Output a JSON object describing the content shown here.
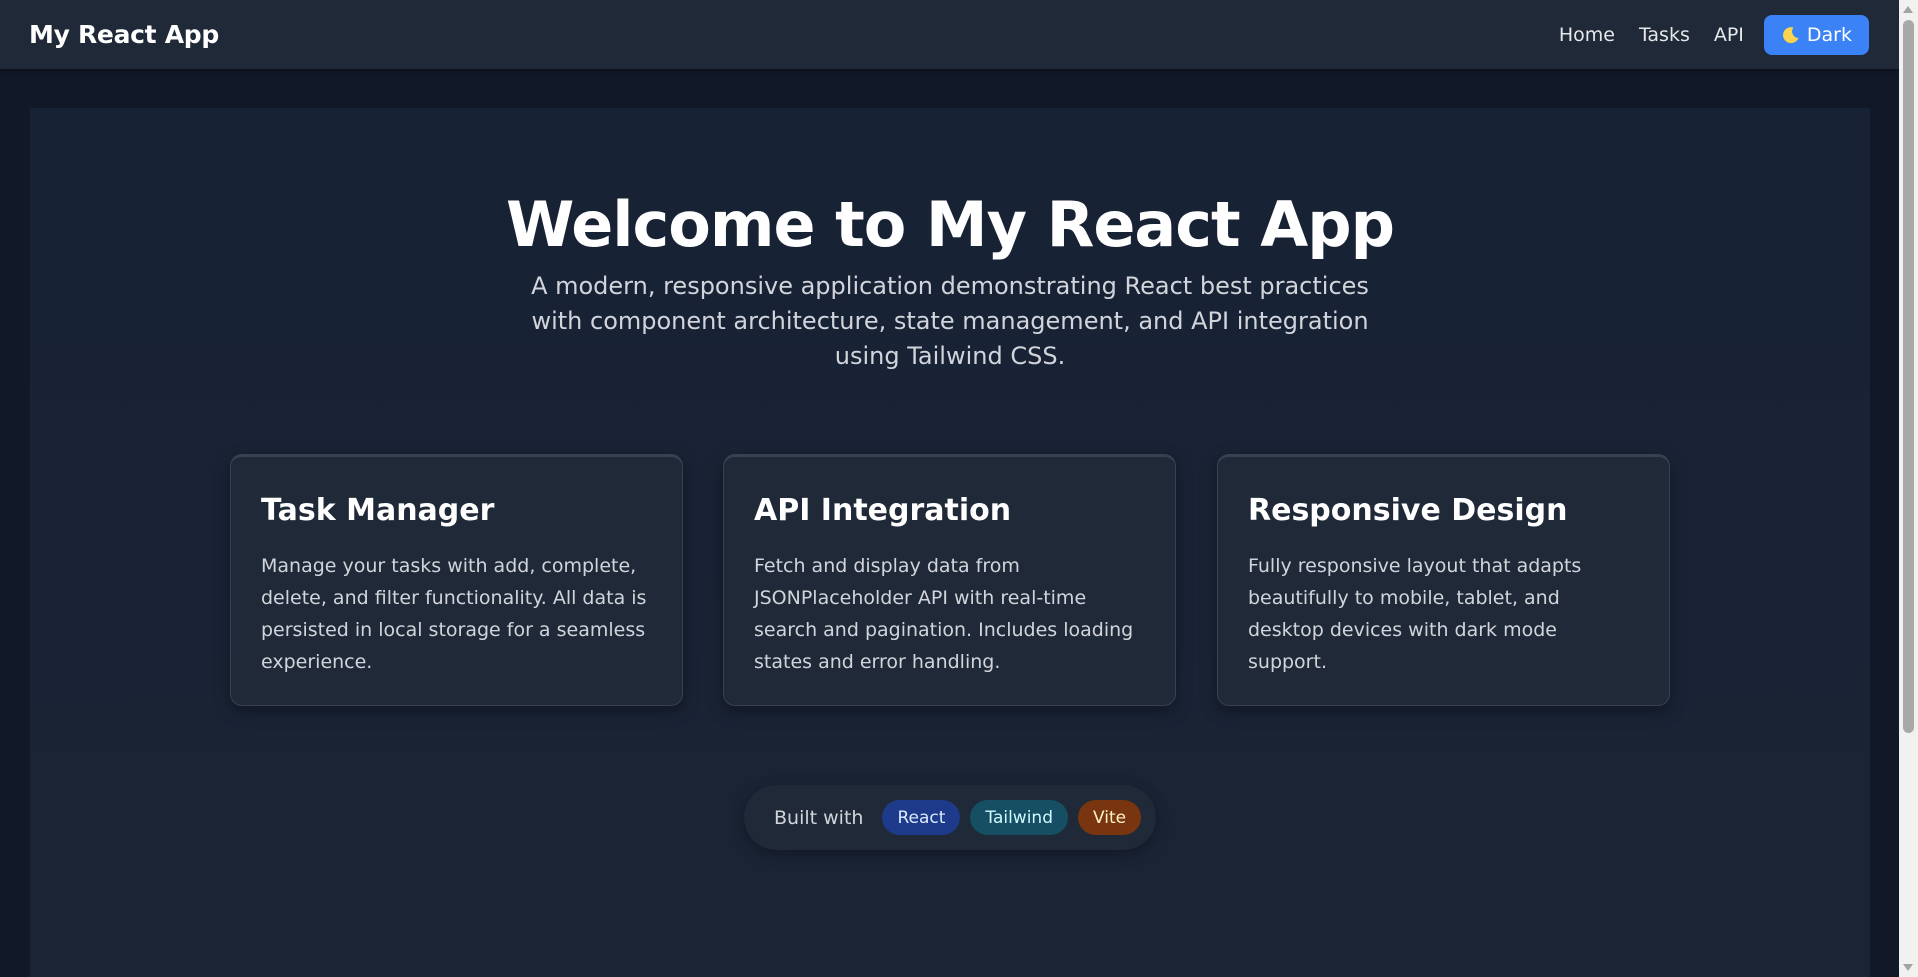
{
  "navbar": {
    "brand": "My React App",
    "links": [
      "Home",
      "Tasks",
      "API"
    ],
    "theme_button": {
      "icon": "moon-icon",
      "label": "Dark"
    }
  },
  "hero": {
    "title": "Welcome to My React App",
    "subtitle": "A modern, responsive application demonstrating React best practices with component architecture, state management, and API integration using Tailwind CSS."
  },
  "features": [
    {
      "title": "Task Manager",
      "description": "Manage your tasks with add, complete, delete, and filter functionality. All data is persisted in local storage for a seamless experience."
    },
    {
      "title": "API Integration",
      "description": "Fetch and display data from JSONPlaceholder API with real-time search and pagination. Includes loading states and error handling."
    },
    {
      "title": "Responsive Design",
      "description": "Fully responsive layout that adapts beautifully to mobile, tablet, and desktop devices with dark mode support."
    }
  ],
  "built_with": {
    "label": "Built with",
    "tags": [
      "React",
      "Tailwind",
      "Vite"
    ]
  },
  "colors": {
    "accent": "#3b82f6",
    "navbar_bg": "#1f2937",
    "page_bg": "#111827"
  }
}
